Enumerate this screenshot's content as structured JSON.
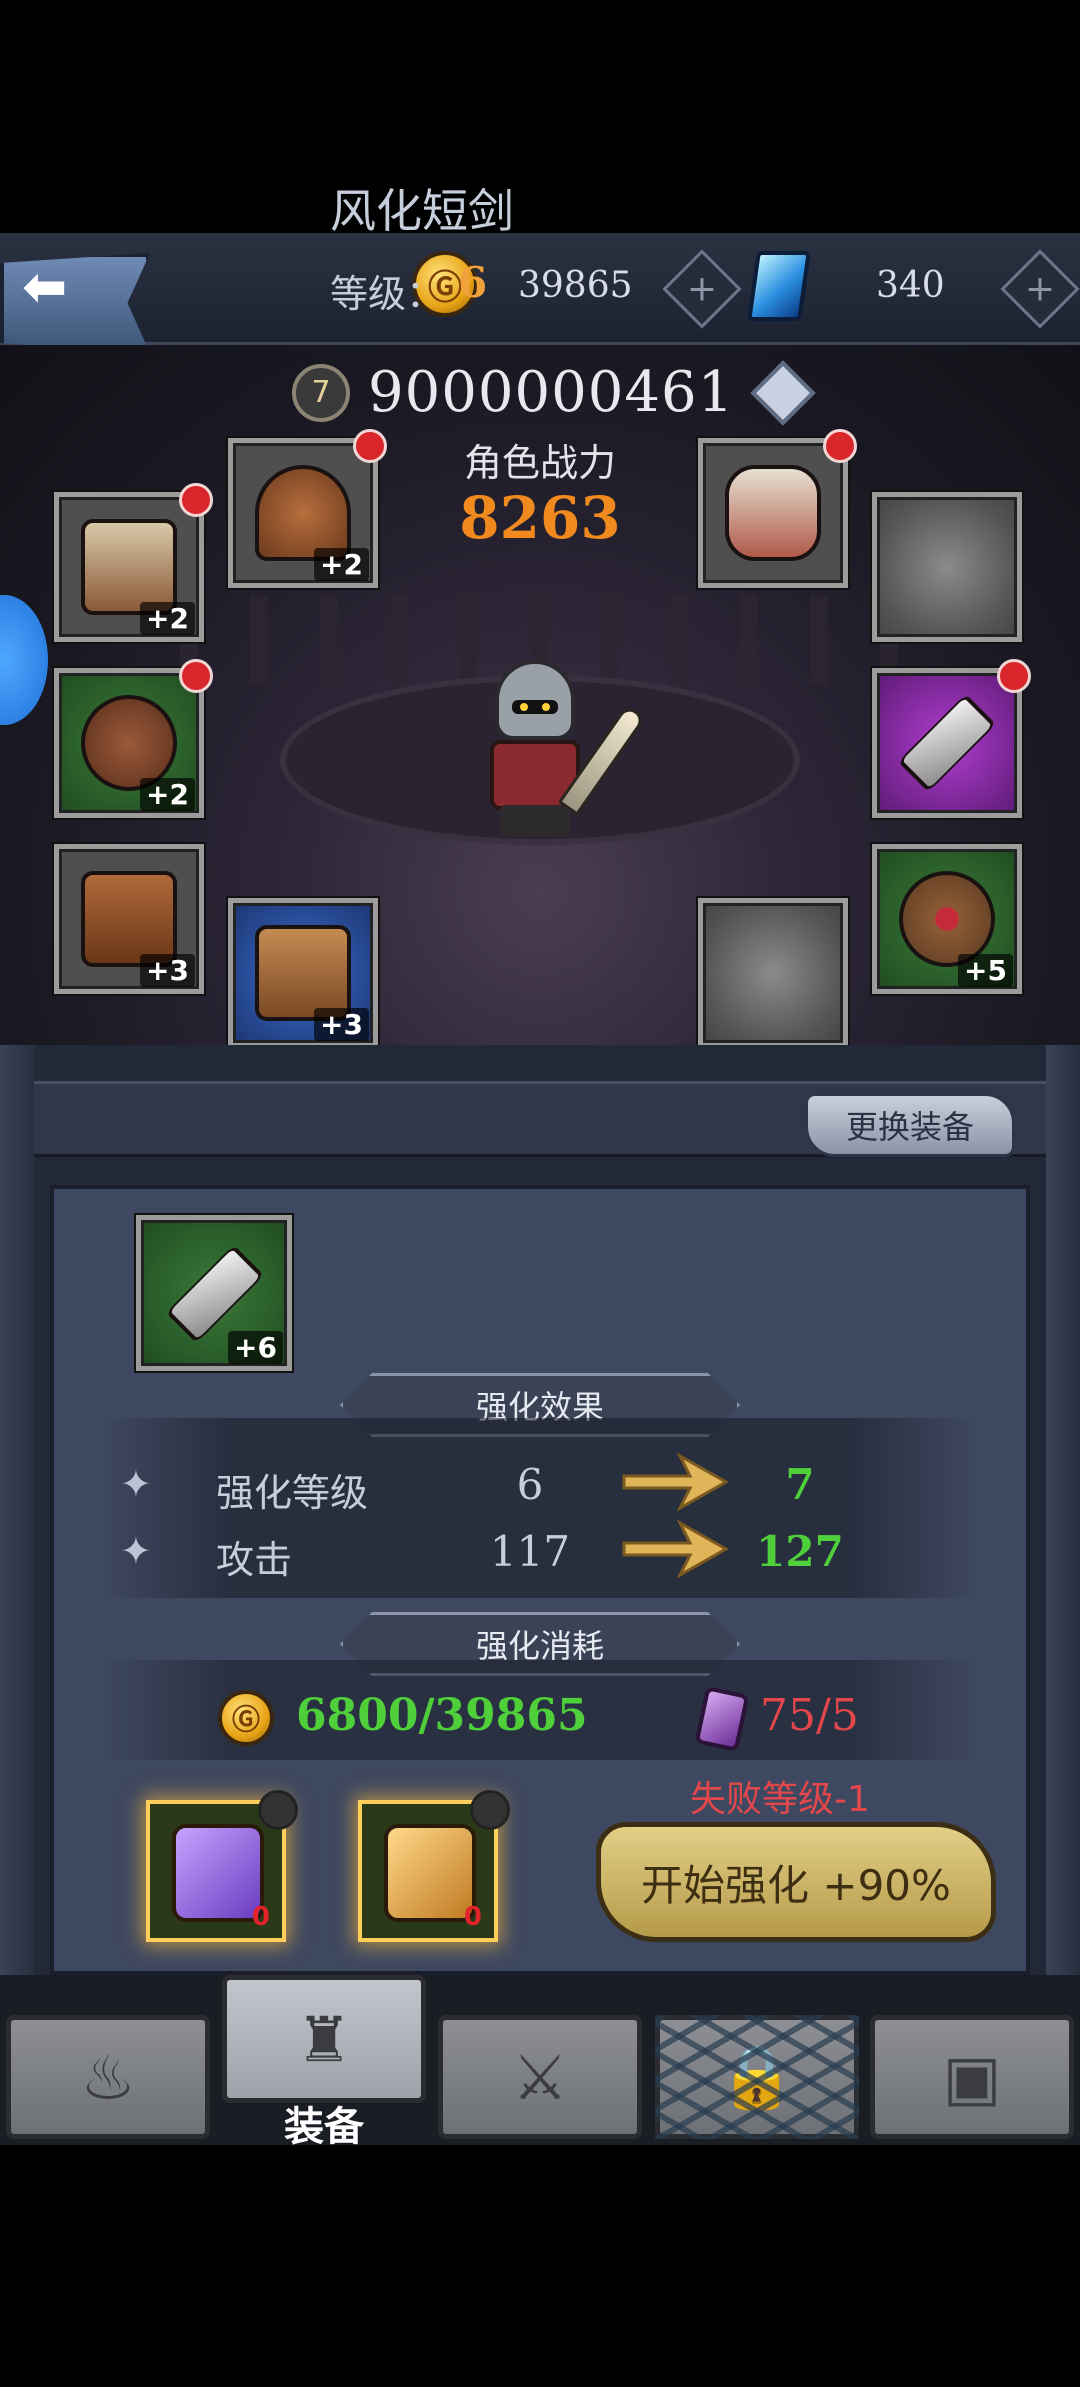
{
  "currencies": {
    "gold_symbol": "Ⓖ",
    "gold": "39865",
    "gems": "340"
  },
  "player": {
    "level": "7",
    "id": "9000000461",
    "power_label": "角色战力",
    "power": "8263"
  },
  "equipment_slots": [
    {
      "name": "armor",
      "plus": "+2",
      "alert": true
    },
    {
      "name": "helmet",
      "plus": "+2",
      "alert": true
    },
    {
      "name": "necklace",
      "plus": "",
      "alert": true
    },
    {
      "name": "empty",
      "plus": "",
      "alert": false
    },
    {
      "name": "shield",
      "plus": "+2",
      "alert": true
    },
    {
      "name": "sword",
      "plus": "",
      "alert": true
    },
    {
      "name": "pants",
      "plus": "+3",
      "alert": false
    },
    {
      "name": "boots",
      "plus": "+3",
      "alert": false
    },
    {
      "name": "empty",
      "plus": "",
      "alert": false
    },
    {
      "name": "ring",
      "plus": "+5",
      "alert": false
    }
  ],
  "panel": {
    "change_button": "更换装备",
    "item": {
      "name": "风化短剑",
      "level_label": "等级：",
      "level": "6",
      "plus": "+6"
    },
    "effect_title": "强化效果",
    "effects": [
      {
        "label": "强化等级",
        "from": "6",
        "to": "7"
      },
      {
        "label": "攻击",
        "from": "117",
        "to": "127"
      }
    ],
    "cost_title": "强化消耗",
    "cost_gold": "6800/39865",
    "cost_stone": "75/5",
    "scrolls": [
      {
        "color": "purple",
        "count": "0"
      },
      {
        "color": "gold",
        "count": "0"
      }
    ],
    "fail_text": "失败等级-1",
    "start_button": "开始强化 +90%"
  },
  "nav": {
    "active_label": "装备",
    "items": [
      "campfire-icon",
      "helmet-icon",
      "crossed-swords-icon",
      "locked-icon",
      "chest-icon"
    ]
  },
  "colors": {
    "power": "#f08a1e",
    "green_value": "#4fcf3a",
    "red_value": "#e2484b",
    "level_orange": "#f0a13a"
  }
}
